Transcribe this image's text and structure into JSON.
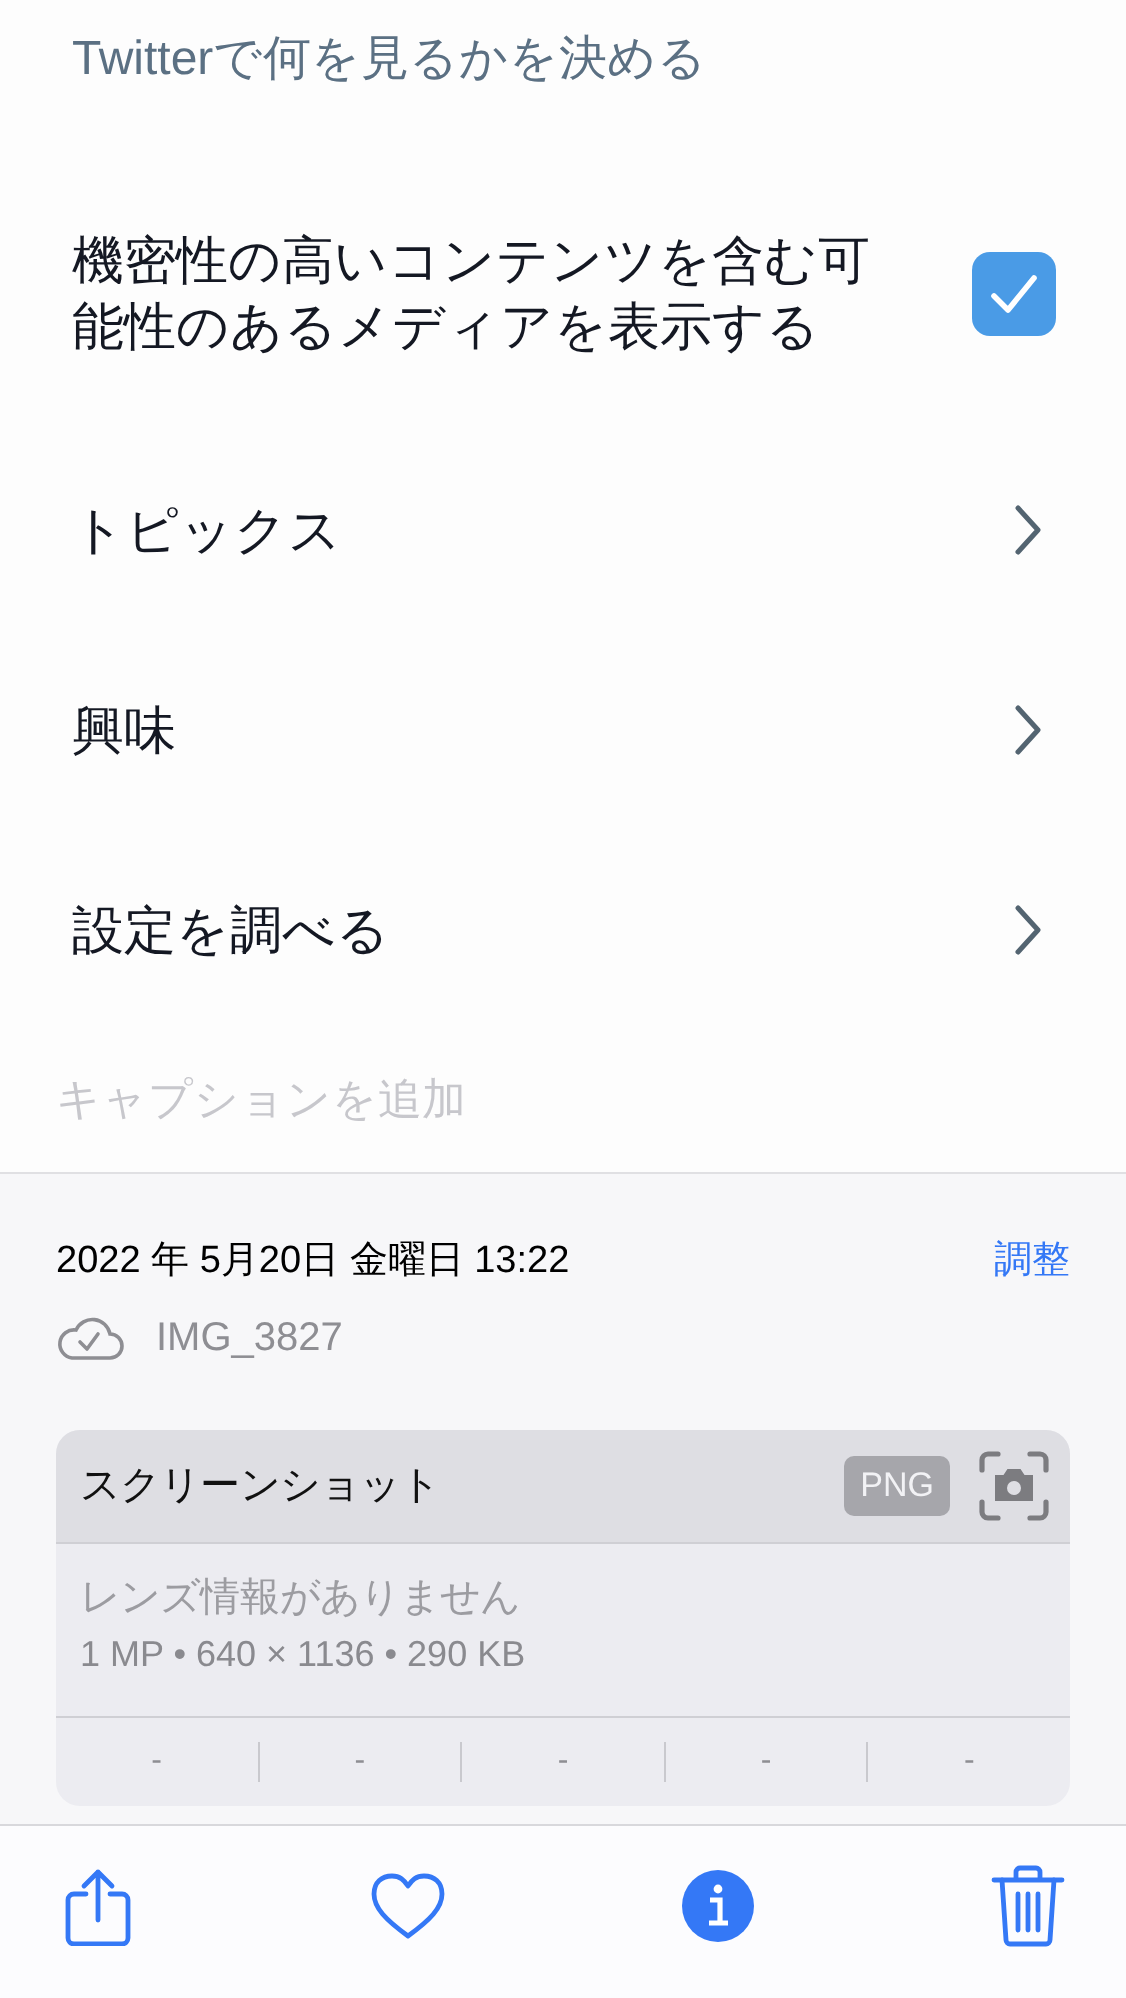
{
  "photo": {
    "description": "Twitterで何を見るかを決める",
    "checkbox_row": {
      "label": "機密性の高いコンテンツを含む可能性のあるメディアを表示する",
      "checked": true
    },
    "rows": [
      {
        "label": "トピックス"
      },
      {
        "label": "興味"
      },
      {
        "label": "設定を調べる"
      }
    ]
  },
  "caption": {
    "placeholder": "キャプションを追加"
  },
  "info": {
    "date": "2022 年 5月20日 金曜日 13:22",
    "adjust": "調整",
    "filename": "IMG_3827",
    "card": {
      "title": "スクリーンショット",
      "format": "PNG",
      "lens": "レンズ情報がありません",
      "specs": "1 MP • 640 × 1136 • 290 KB",
      "exif": [
        "-",
        "-",
        "-",
        "-",
        "-"
      ]
    }
  },
  "toolbar": [
    {
      "kind": "share",
      "selected": false
    },
    {
      "kind": "favorite",
      "selected": false
    },
    {
      "kind": "info",
      "selected": true
    },
    {
      "kind": "delete",
      "selected": false
    }
  ]
}
